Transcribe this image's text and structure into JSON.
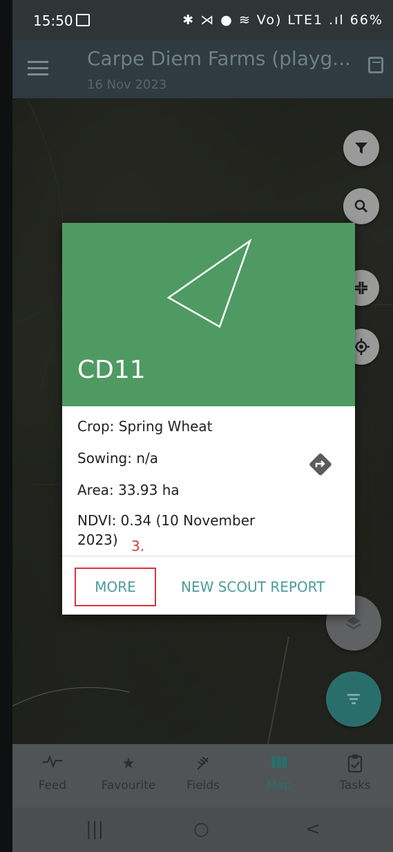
{
  "status_bar": {
    "time": "15:50",
    "right_icons": "✱ ⋊ ● ≋ Vo) LTE1 .ıl",
    "battery": "66%"
  },
  "app_bar": {
    "title": "Carpe Diem Farms (playg...",
    "date": "16 Nov 2023"
  },
  "map_controls": {
    "filter_icon": "filter-icon",
    "search_icon": "search-icon",
    "collapse_icon": "collapse-icon",
    "locate_icon": "locate-icon",
    "layers_icon": "layers-icon",
    "list_filter_icon": "list-filter-icon"
  },
  "field_card": {
    "name": "CD11",
    "crop": "Crop: Spring Wheat",
    "sowing": "Sowing: n/a",
    "area": "Area: 33.93 ha",
    "ndvi_line1": "NDVI: 0.34 (10 November",
    "ndvi_line2": "2023)",
    "annotation": "3.",
    "more_label": "MORE",
    "scout_label": "NEW SCOUT REPORT",
    "header_color": "#4f9a63",
    "action_color": "#4a9d98"
  },
  "bottom_nav": {
    "tabs": [
      {
        "label": "Feed",
        "icon": "activity-icon"
      },
      {
        "label": "Favourite",
        "icon": "star-icon"
      },
      {
        "label": "Fields",
        "icon": "wheat-icon"
      },
      {
        "label": "Map",
        "icon": "map-icon",
        "active": true
      },
      {
        "label": "Tasks",
        "icon": "clipboard-check-icon"
      }
    ]
  },
  "system_nav": {
    "recent": "|||",
    "home": "○",
    "back": "<"
  }
}
